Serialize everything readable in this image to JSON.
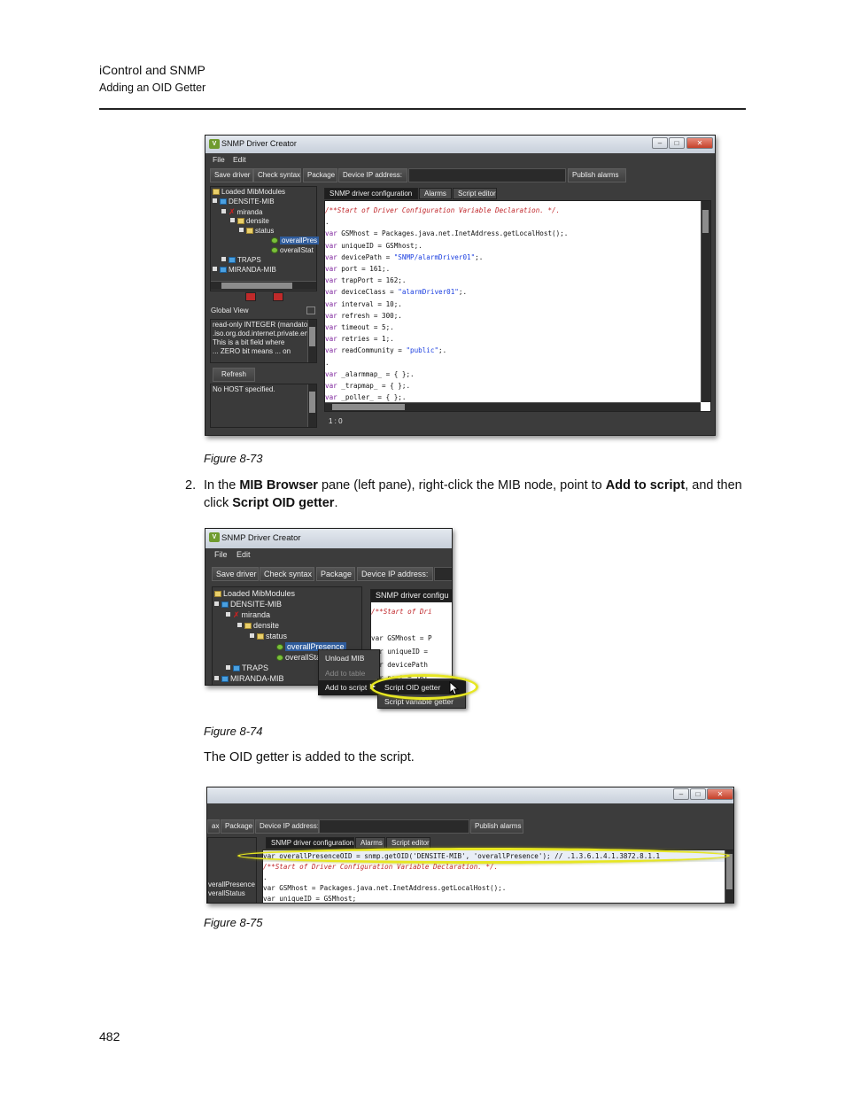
{
  "header": {
    "title": "iControl and SNMP",
    "subtitle": "Adding an OID Getter"
  },
  "figures": {
    "fig73": "Figure 8-73",
    "fig74": "Figure 8-74",
    "fig75": "Figure 8-75"
  },
  "step2": {
    "number": "2.",
    "t1": "In the ",
    "b1": "MIB Browser",
    "t2": " pane (left pane), right-click the MIB node, point to ",
    "b2": "Add to script",
    "t3": ", and then click ",
    "b3": "Script OID getter",
    "t4": "."
  },
  "result_text": "The OID getter is added to the script.",
  "page_number": "482",
  "app": {
    "window_title": "SNMP Driver Creator",
    "menu": [
      "File",
      "Edit"
    ],
    "toolbar": {
      "save": "Save driver",
      "check": "Check syntax",
      "package": "Package",
      "device_ip": "Device IP address:",
      "publish": "Publish alarms"
    },
    "tabs": [
      "SNMP driver configuration",
      "Alarms",
      "Script editor"
    ],
    "tree": {
      "root": "Loaded MibModules",
      "mib": "DENSITE-MIB",
      "miranda": "miranda",
      "densite": "densite",
      "status": "status",
      "presence_short": "overallPres",
      "status_short": "overallStat",
      "presence": "overallPresence",
      "status_item": "overallStatus",
      "traps": "TRAPS",
      "mib2": "MIRANDA-MIB"
    },
    "global_view": "Global View",
    "info_lines": [
      "read-only INTEGER  (mandato",
      ".iso.org.dod.internet.private.en",
      "This is a bit field where",
      "... ZERO bit means ... on"
    ],
    "refresh": "Refresh",
    "no_host": "No HOST specified.",
    "status_pos": "1 : 0",
    "code": [
      {
        "p": "/**Start of Driver Configuration Variable Declaration. */.",
        "k": "cmt"
      },
      {
        "p": ".",
        "k": "plain"
      },
      {
        "p": "var GSMhost = Packages.java.net.InetAddress.getLocalHost();.",
        "k": "var"
      },
      {
        "p": "var uniqueID = GSMhost;.",
        "k": "var"
      },
      {
        "p": "var devicePath = \"SNMP/alarmDriver01\";.",
        "k": "var"
      },
      {
        "p": "var port = 161;.",
        "k": "var"
      },
      {
        "p": "var trapPort = 162;.",
        "k": "var"
      },
      {
        "p": "var deviceClass = \"alarmDriver01\";.",
        "k": "var"
      },
      {
        "p": "var interval = 10;.",
        "k": "var"
      },
      {
        "p": "var refresh = 300;.",
        "k": "var"
      },
      {
        "p": "var timeout = 5;.",
        "k": "var"
      },
      {
        "p": "var retries = 1;.",
        "k": "var"
      },
      {
        "p": "var readCommunity = \"public\";.",
        "k": "var"
      },
      {
        "p": ".",
        "k": "plain"
      },
      {
        "p": "var _alarmmap_ = { };.",
        "k": "var"
      },
      {
        "p": "var _trapmap_ = { };.",
        "k": "var"
      },
      {
        "p": "var _poller_ = { };.",
        "k": "var"
      }
    ],
    "context_menu": [
      "Unload MIB",
      "Add to table",
      "Add to script"
    ],
    "submenu": [
      "Script OID getter",
      "Script variable getter"
    ],
    "fig74_code": [
      "/**Start of Dri",
      "var GSMhost = P",
      "var uniqueID =",
      "var devicePath",
      "var port = 161"
    ],
    "fig74_tab": "SNMP driver configu",
    "fig75_toolbar": [
      "ax",
      "Package",
      "Device IP address:",
      "Publish alarms"
    ],
    "fig75_code": [
      "var overallPresenceOID = snmp.getOID('DENSITE-MIB', 'overallPresence'); // .1.3.6.1.4.1.3872.8.1.1",
      "/**Start of Driver Configuration Variable Declaration. */.",
      ".",
      "var GSMhost = Packages.java.net.InetAddress.getLocalHost();.",
      "var uniqueID = GSMhost;"
    ],
    "fig75_tree": [
      "verallPresence",
      "verallStatus"
    ]
  }
}
